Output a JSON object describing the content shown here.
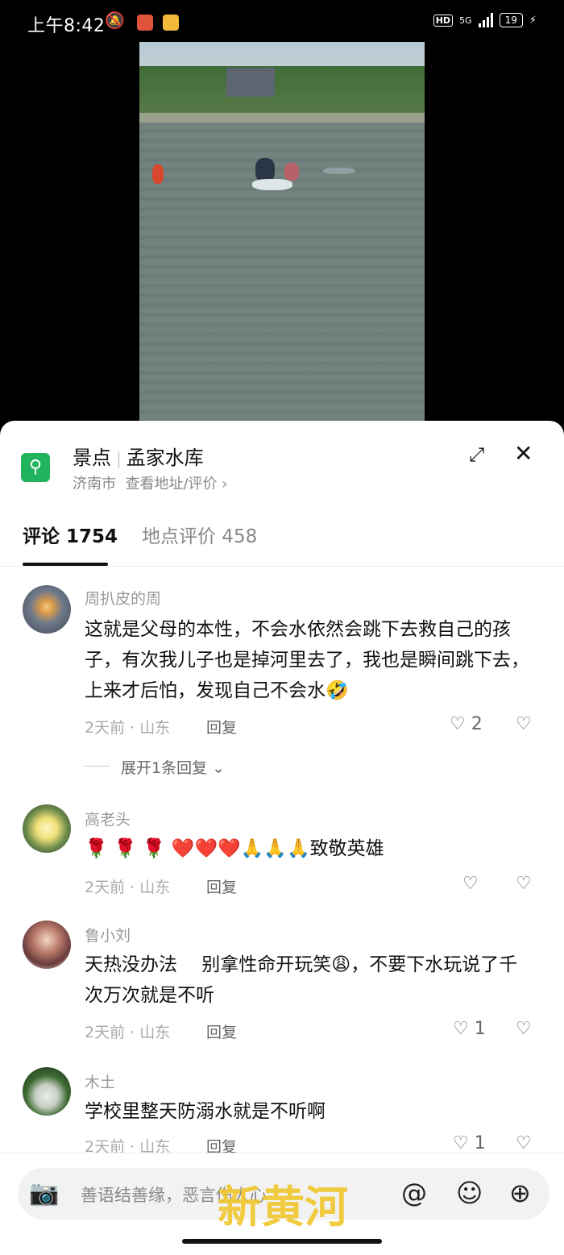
{
  "status_bar": {
    "time": "上午8:42",
    "network": "5G",
    "hd": "HD",
    "battery": "19"
  },
  "location": {
    "category": "景点",
    "name": "孟家水库",
    "city": "济南市",
    "link": "查看地址/评价 ›"
  },
  "tabs": [
    {
      "label": "评论 1754"
    },
    {
      "label": "地点评价 458"
    }
  ],
  "comments": [
    {
      "user": "周扒皮的周",
      "text": "这就是父母的本性，不会水依然会跳下去救自己的孩子，有次我儿子也是掉河里去了，我也是瞬间跳下去，上来才后怕，发现自己不会水🤣",
      "meta": "2天前 · 山东",
      "reply": "回复",
      "likes": "2",
      "expand": "展开1条回复 ⌄"
    },
    {
      "user": "高老头",
      "text": "🌹 🌹 🌹 ❤️❤️❤️🙏🙏🙏致敬英雄",
      "meta": "2天前 · 山东",
      "reply": "回复",
      "likes": ""
    },
    {
      "user": "鲁小刘",
      "text": "天热没办法　 别拿性命开玩笑😩，不要下水玩说了千次万次就是不听",
      "meta": "2天前 · 山东",
      "reply": "回复",
      "likes": "1"
    },
    {
      "user": "木土",
      "text": "学校里整天防溺水就是不听啊",
      "meta": "2天前 · 山东",
      "reply": "回复",
      "likes": "1"
    }
  ],
  "input": {
    "placeholder": "善语结善缘，恶言伤人心"
  },
  "watermark": "新黄河",
  "colors": {
    "location_icon": "#22b35e",
    "watermark": "#f0c62c"
  }
}
